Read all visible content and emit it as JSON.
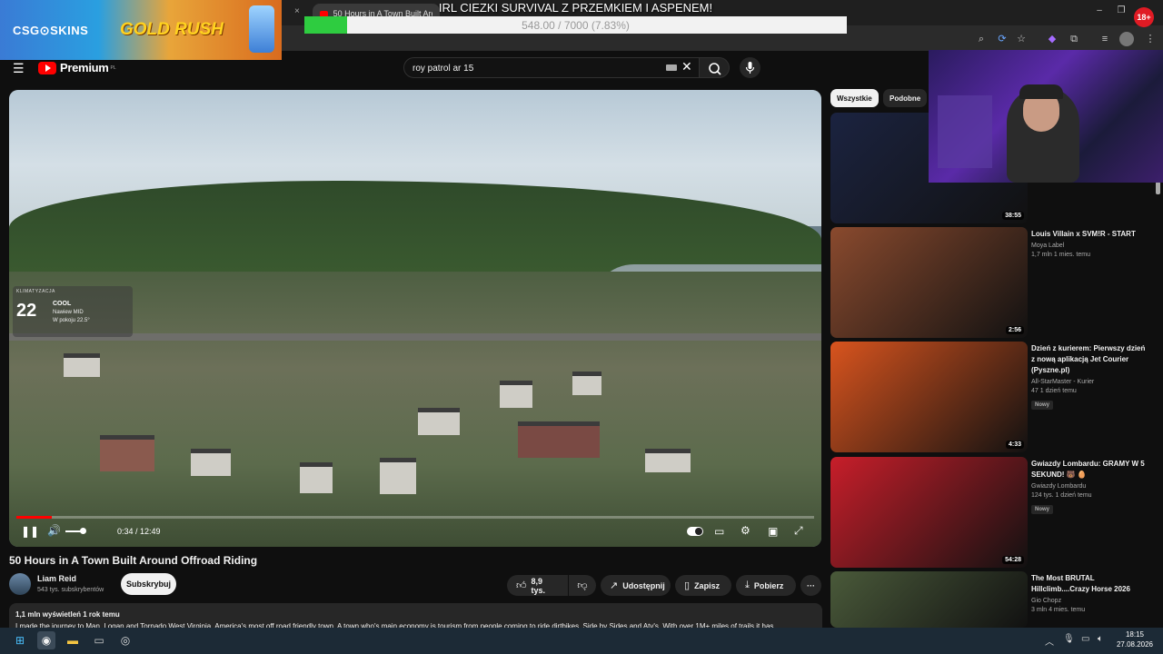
{
  "browser": {
    "tab_title": "50 Hours in A Town Built Around",
    "tab_close": "×",
    "win_min": "–",
    "win_max": "❐",
    "win_close": "✕"
  },
  "overlay": {
    "sponsor_brand": "CSG⊙SKINS",
    "sponsor_promo": "GOLD RUSH",
    "goal_title": "IRL CIEZKI SURVIVAL Z PRZEMKIEM I ASPENEM!",
    "goal_text": "548.00 / 7000 (7.83%)",
    "goal_current": 548,
    "goal_target": 7000,
    "goal_color": "#2ecc40",
    "age_badge": "18+"
  },
  "header": {
    "logo_word": "Premium",
    "logo_sup": "PL",
    "search_value": "roy patrol ar 15"
  },
  "player": {
    "climate_label": "KLIMATYZACJA",
    "climate_temp": "22",
    "climate_mode": "COOL",
    "climate_fan": "Nawiew MID",
    "climate_room": "W pokoju 22.5°",
    "time": "0:34 / 12:49",
    "progress": 0.044
  },
  "video": {
    "title": "50 Hours in A Town Built Around Offroad Riding",
    "channel": "Liam Reid",
    "subscribers": "543 tys. subskrybentów",
    "subscribe_label": "Subskrybuj",
    "likes": "8,9 tys.",
    "share_label": "Udostępnij",
    "save_label": "Zapisz",
    "download_label": "Pobierz",
    "more_label": "···",
    "stats": "1,1 mln wyświetleń  1 rok temu",
    "description": "I made the journey to Man, Logan and Tornado West Virginia, America's most off road friendly town. A town who's main economy is tourism from people coming to ride dirtbikes, Side by Sides and Atv's. With over 1M+ miles of trails it has"
  },
  "sidebar": {
    "chips": [
      "Wszystkie",
      "Podobne"
    ],
    "cards": [
      {
        "title": "",
        "channel": "",
        "views": "",
        "ago": "",
        "badge": "",
        "duration": "38:55",
        "thumb_color": "#1b2340"
      },
      {
        "title": "Louis Villain x SVM!R - START",
        "channel": "Moya Label",
        "views": "1,7 mln",
        "ago": "1 mies. temu",
        "badge": "",
        "duration": "2:56",
        "thumb_color": "#8a4a2e"
      },
      {
        "title": "Dzień z kurierem: Pierwszy dzień z nową aplikacją Jet Courier (Pyszne.pl)",
        "channel": "All-StarMaster - Kurier",
        "views": "47",
        "ago": "1 dzień temu",
        "badge": "Nowy",
        "duration": "4:33",
        "thumb_color": "#d9541e"
      },
      {
        "title": "Gwiazdy Lombardu: GRAMY W 5 SEKUND! 🐻 🥚",
        "channel": "Gwiazdy Lombardu",
        "views": "124 tys.",
        "ago": "1 dzień temu",
        "badge": "Nowy",
        "duration": "54:28",
        "thumb_color": "#c81e2a"
      },
      {
        "title": "The Most BRUTAL Hillclimb....Crazy Horse 2026",
        "channel": "Gio Chopz",
        "views": "3 mln",
        "ago": "4 mies. temu",
        "badge": "",
        "duration": "",
        "thumb_color": "#4a5a3a"
      }
    ]
  },
  "taskbar": {
    "time": "18:15",
    "date": "27.08.2026"
  }
}
